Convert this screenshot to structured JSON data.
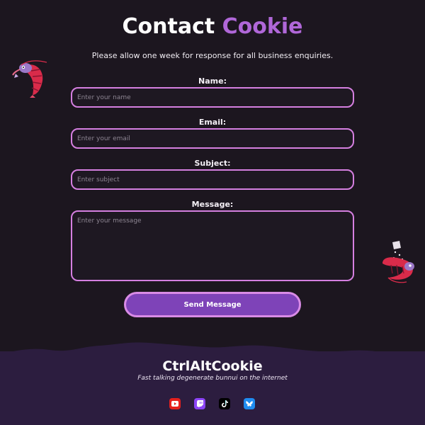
{
  "header": {
    "title_main": "Contact",
    "title_accent": "Cookie",
    "subtitle": "Please allow one week for response for all business enquiries."
  },
  "form": {
    "name": {
      "label": "Name:",
      "placeholder": "Enter your name"
    },
    "email": {
      "label": "Email:",
      "placeholder": "Enter your email"
    },
    "subject": {
      "label": "Subject:",
      "placeholder": "Enter subject"
    },
    "message": {
      "label": "Message:",
      "placeholder": "Enter your message"
    },
    "submit_label": "Send Message"
  },
  "footer": {
    "title": "CtrlAltCookie",
    "tagline": "Fast talking degenerate bunnui on the internet",
    "socials": [
      {
        "icon": "youtube-icon",
        "color": "#e5201d"
      },
      {
        "icon": "twitch-icon",
        "color": "#8c44f7"
      },
      {
        "icon": "tiktok-icon",
        "color": "#000000"
      },
      {
        "icon": "bluesky-icon",
        "color": "#1f8cf0"
      }
    ]
  },
  "colors": {
    "background": "#1c161f",
    "accent": "#b067d8",
    "field_border": "#d57fe0",
    "button": "#7e43b8",
    "footer": "#2c1d3f"
  }
}
